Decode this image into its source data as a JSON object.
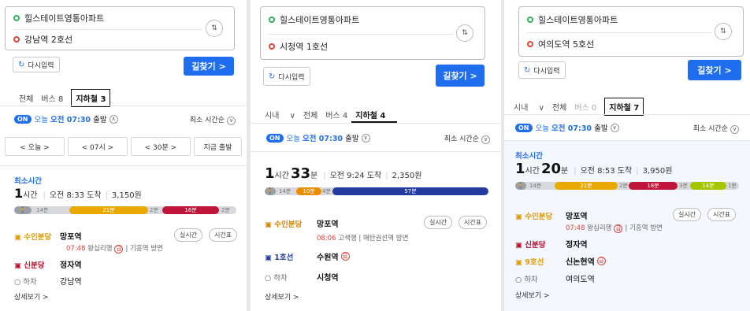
{
  "common": {
    "redo": "다시입력",
    "go": "길찾기 >",
    "tab_all": "전체",
    "ontoggle": "ON",
    "sort": "최소 시간순",
    "more": "상세보기 >",
    "realtime": "실시간",
    "timetable": "시간표",
    "hacha": "하차",
    "min_label": "최소시간",
    "area": "시내"
  },
  "p1": {
    "origin": "힐스테이트영통아파트",
    "dest": "강남역 2호선",
    "tab_bus": "버스 8",
    "tab_sub": "지하철 3",
    "dep_pre": "오늘",
    "dep_time": "오전 07:30",
    "dep_post": "출발",
    "tb": [
      "<   오늘   >",
      "<  07시  >",
      "<  30분  >",
      "지금 출발"
    ],
    "hour": "1",
    "hour_u": "시간",
    "arrive": "오전 8:33 도착",
    "fare": "3,150원",
    "seg": [
      "14분",
      "21분",
      "2분",
      "16분",
      "2분"
    ],
    "step1_line": "수인분당",
    "step1_st": "망포역",
    "step1_tm": "07:48",
    "step1_txt": "왕십리행",
    "step1_dir": "기흥역 방면",
    "step2_line": "신분당",
    "step2_st": "정자역",
    "step3_st": "강남역"
  },
  "p2": {
    "origin": "힐스테이트영통아파트",
    "dest": "시청역 1호선",
    "tab_bus": "버스 4",
    "tab_sub": "지하철 4",
    "dep_pre": "오늘",
    "dep_time": "오전 07:30",
    "dep_post": "출발",
    "hour": "1",
    "hour_u": "시간",
    "min": "33",
    "min_u": "분",
    "arrive": "오전 9:24 도착",
    "fare": "2,350원",
    "seg": [
      "14분",
      "10분",
      "4분",
      "57분"
    ],
    "step1_line": "수인분당",
    "step1_st": "망포역",
    "step1_tm": "08:06",
    "step1_txt": "고색행",
    "step1_dir": "매탄권선역 방면",
    "step2_line": "1호선",
    "step2_st": "수원역",
    "step3_st": "시청역"
  },
  "p3": {
    "origin": "힐스테이트영통아파트",
    "dest": "여의도역 5호선",
    "tab_bus": "버스 0",
    "tab_sub": "지하철 7",
    "dep_pre": "오늘",
    "dep_time": "오전 07:30",
    "dep_post": "출발",
    "hour": "1",
    "hour_u": "시간",
    "min": "20",
    "min_u": "분",
    "arrive": "오전 8:53 도착",
    "fare": "3,950원",
    "seg": [
      "14분",
      "21분",
      "2분",
      "18분",
      "3분",
      "14분",
      "1분"
    ],
    "step1_line": "수인분당",
    "step1_st": "망포역",
    "step1_tm": "07:48",
    "step1_txt": "왕십리행",
    "step1_dir": "기흥역 방면",
    "step2_line": "신분당",
    "step2_st": "정자역",
    "step3_line": "9호선",
    "step3_st": "신논현역",
    "step4_st": "여의도역"
  },
  "colors": {
    "accent": "#1f6ef0",
    "suin": "#e9a900",
    "sinbundang": "#c0153a",
    "line1": "#233b9e",
    "line9": "#a5c600"
  }
}
